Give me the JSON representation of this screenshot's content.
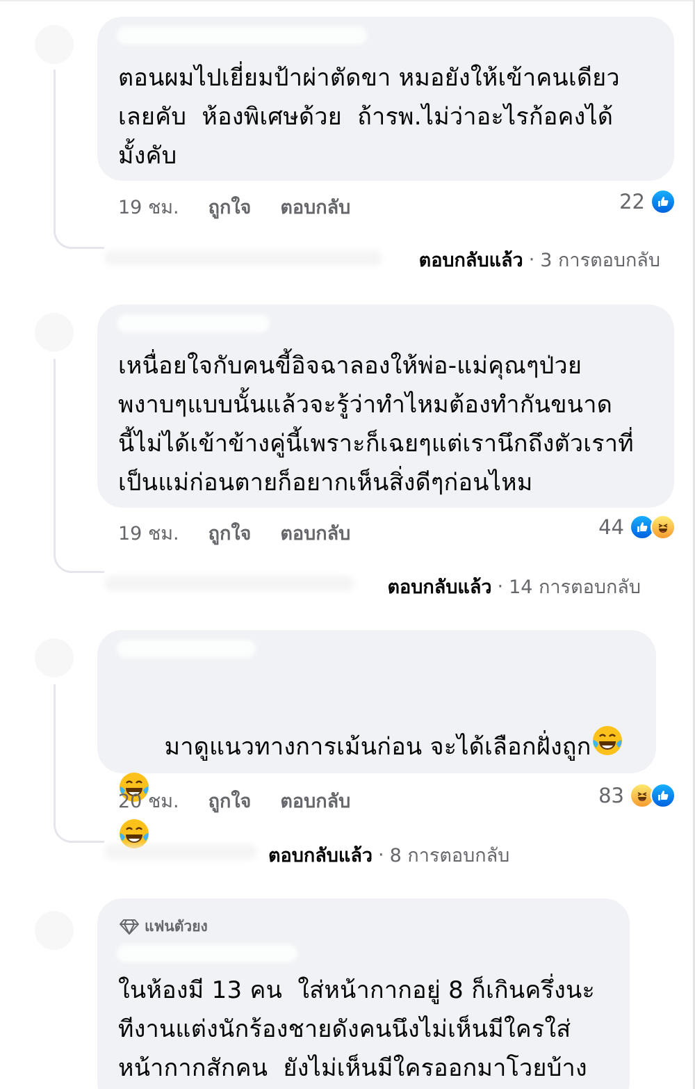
{
  "comments": [
    {
      "text": "ตอนผมไปเยี่ยมป้าผ่าตัดขา หมอยังให้เข้าคนเดียว\nเลยคับ  ห้องพิเศษด้วย  ถ้ารพ.ไม่ว่าอะไรก้อคงได้\nมั้งคับ",
      "time": "19 ชม.",
      "like_label": "ถูกใจ",
      "reply_label": "ตอบกลับ",
      "reaction_count": "22",
      "reactions": [
        "like-icon"
      ],
      "replied_label": "ตอบกลับแล้ว",
      "reply_count_label": "3 การตอบกลับ"
    },
    {
      "text": "เหนื่อยใจกับคนขี้อิจฉาลองให้พ่อ-แม่คุณๆป่วย\nพงาบๆแบบนั้นแล้วจะรู้ว่าทำไหมต้องทำกันขนาด\nนี้ไม่ได้เข้าข้างคู่นี้เพราะก็เฉยๆแต่เรานึกถึงตัวเราที่\nเป็นแม่ก่อนตายก็อยากเห็นสิ่งดีๆก่อนไหม",
      "time": "19 ชม.",
      "like_label": "ถูกใจ",
      "reply_label": "ตอบกลับ",
      "reaction_count": "44",
      "reactions": [
        "like-icon",
        "haha-icon"
      ],
      "replied_label": "ตอบกลับแล้ว",
      "reply_count_label": "14 การตอบกลับ"
    },
    {
      "text": "มาดูแนวทางการเม้นก่อน จะได้เลือกฝั่งถูก",
      "emoji_name": "tears-of-joy-emoji",
      "time": "20 ชม.",
      "like_label": "ถูกใจ",
      "reply_label": "ตอบกลับ",
      "reaction_count": "83",
      "reactions": [
        "haha-icon",
        "like-icon"
      ],
      "replied_label": "ตอบกลับแล้ว",
      "reply_count_label": "8 การตอบกลับ"
    },
    {
      "badge": "แฟนตัวยง",
      "badge_icon": "diamond-icon",
      "text": "ในห้องมี 13 คน  ใส่หน้ากากอยู่ 8 ก็เกินครึ่งนะ\nทีงานแต่งนักร้องชายดังคนนึงไม่เห็นมีใครใส่\nหน้ากากสักคน  ยังไม่เห็นมีใครออกมาโวยบ้าง"
    }
  ],
  "separator": "·",
  "colors": {
    "bubble": "#f0f2f5",
    "meta_text": "#65676b",
    "like_blue": "#0062df",
    "haha_yellow": "#f69b30"
  }
}
